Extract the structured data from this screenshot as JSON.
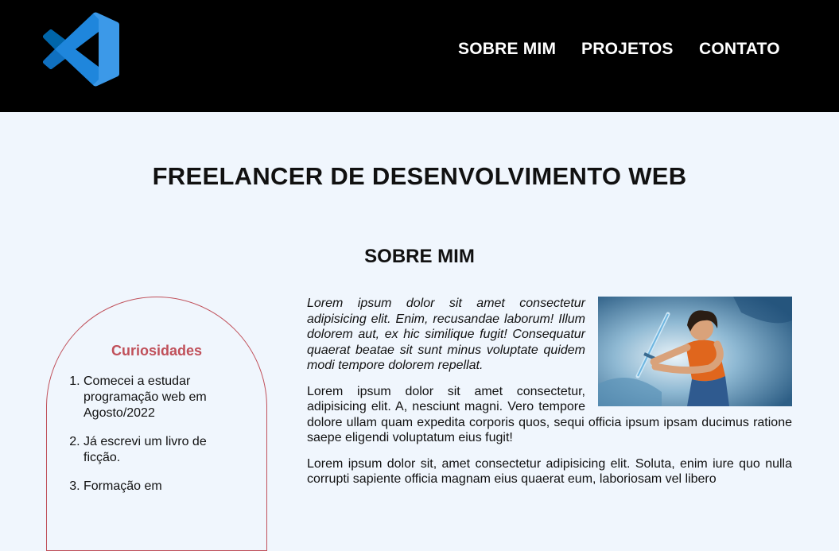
{
  "header": {
    "logo": {
      "icon": "vscode-logo-icon",
      "colors": [
        "#0065a9",
        "#1e8ae0",
        "#3c99e8"
      ]
    },
    "nav": [
      {
        "label": "SOBRE MIM"
      },
      {
        "label": "PROJETOS"
      },
      {
        "label": "CONTATO"
      }
    ]
  },
  "main": {
    "title": "FREELANCER DE DESENVOLVIMENTO WEB",
    "section_title": "SOBRE MIM",
    "aside": {
      "title": "Curiosidades",
      "items": [
        "Comecei a estudar programação web em Agosto/2022",
        "Já escrevi um livro de ficção.",
        "Formação em"
      ]
    },
    "paragraphs": [
      "Lorem ipsum dolor sit amet consectetur adipisicing elit. Enim, recusandae laborum! Illum dolorem aut, ex hic similique fugit! Consequatur quaerat beatae sit sunt minus voluptate quidem modi tempore dolorem repellat.",
      "Lorem ipsum dolor sit amet consectetur, adipisicing elit. A, nesciunt magni. Vero tempore dolore ullam quam expedita corporis quos, sequi officia ipsum ipsam ducimus ratione saepe eligendi voluptatum eius fugit!",
      "Lorem ipsum dolor sit, amet consectetur adipisicing elit. Soluta, enim iure quo nulla corrupti sapiente officia magnam eius quaerat eum, laboriosam vel libero"
    ],
    "image": {
      "subject": "illustration of a boy holding a glowing sword",
      "accent": "#e0661d"
    }
  }
}
